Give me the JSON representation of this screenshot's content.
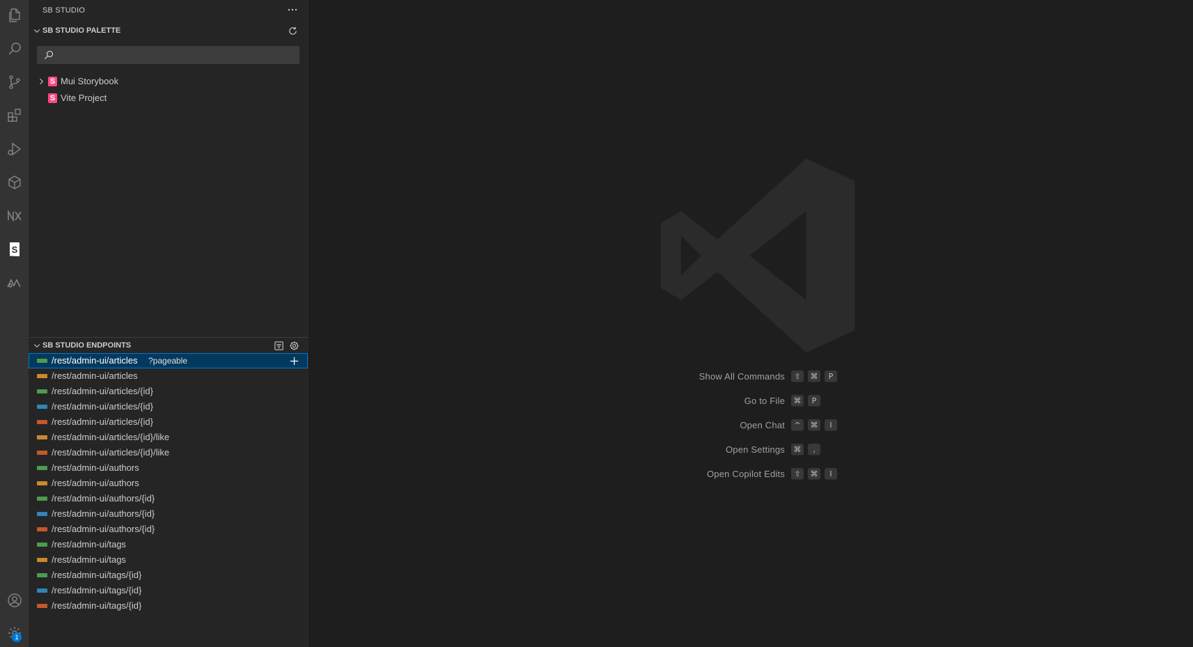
{
  "activity_bar": {
    "items": [
      {
        "name": "explorer-icon"
      },
      {
        "name": "search-icon"
      },
      {
        "name": "source-control-icon"
      },
      {
        "name": "extensions-icon"
      },
      {
        "name": "run-debug-icon"
      },
      {
        "name": "package-icon"
      },
      {
        "name": "nx-icon"
      },
      {
        "name": "storybook-icon"
      },
      {
        "name": "mui-icon"
      }
    ],
    "settings_badge": "1"
  },
  "sidebar": {
    "title": "SB STUDIO",
    "palette": {
      "header": "SB STUDIO PALETTE",
      "search_placeholder": "",
      "items": [
        {
          "label": "Mui Storybook",
          "expandable": true
        },
        {
          "label": "Vite Project",
          "expandable": false
        }
      ]
    },
    "endpoints": {
      "header": "SB STUDIO ENDPOINTS",
      "selected_param": "?pageable",
      "items": [
        {
          "path": "/rest/admin-ui/articles",
          "color": "#4e9a4e"
        },
        {
          "path": "/rest/admin-ui/articles",
          "color": "#c9892e"
        },
        {
          "path": "/rest/admin-ui/articles/{id}",
          "color": "#4e9a4e"
        },
        {
          "path": "/rest/admin-ui/articles/{id}",
          "color": "#2f86b5"
        },
        {
          "path": "/rest/admin-ui/articles/{id}",
          "color": "#c4582c"
        },
        {
          "path": "/rest/admin-ui/articles/{id}/like",
          "color": "#c9892e"
        },
        {
          "path": "/rest/admin-ui/articles/{id}/like",
          "color": "#c4582c"
        },
        {
          "path": "/rest/admin-ui/authors",
          "color": "#4e9a4e"
        },
        {
          "path": "/rest/admin-ui/authors",
          "color": "#c9892e"
        },
        {
          "path": "/rest/admin-ui/authors/{id}",
          "color": "#4e9a4e"
        },
        {
          "path": "/rest/admin-ui/authors/{id}",
          "color": "#2f86b5"
        },
        {
          "path": "/rest/admin-ui/authors/{id}",
          "color": "#c4582c"
        },
        {
          "path": "/rest/admin-ui/tags",
          "color": "#4e9a4e"
        },
        {
          "path": "/rest/admin-ui/tags",
          "color": "#c9892e"
        },
        {
          "path": "/rest/admin-ui/tags/{id}",
          "color": "#4e9a4e"
        },
        {
          "path": "/rest/admin-ui/tags/{id}",
          "color": "#2f86b5"
        },
        {
          "path": "/rest/admin-ui/tags/{id}",
          "color": "#c4582c"
        }
      ]
    }
  },
  "editor": {
    "shortcuts": [
      {
        "label": "Show All Commands",
        "keys": [
          "⇧",
          "⌘",
          "P"
        ]
      },
      {
        "label": "Go to File",
        "keys": [
          "⌘",
          "P"
        ]
      },
      {
        "label": "Open Chat",
        "keys": [
          "^",
          "⌘",
          "I"
        ]
      },
      {
        "label": "Open Settings",
        "keys": [
          "⌘",
          ","
        ]
      },
      {
        "label": "Open Copilot Edits",
        "keys": [
          "⇧",
          "⌘",
          "I"
        ]
      }
    ]
  }
}
